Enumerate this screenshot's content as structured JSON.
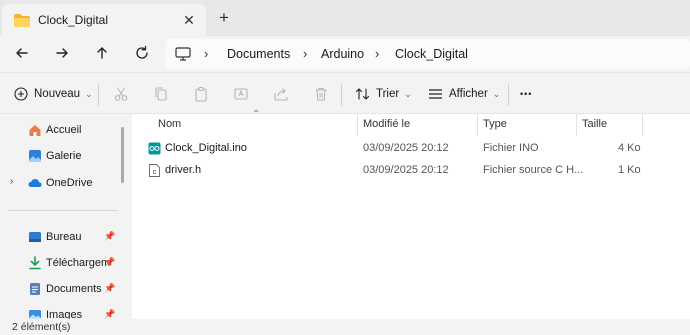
{
  "window": {
    "tab_title": "Clock_Digital",
    "close_symbol": "✕",
    "new_tab_symbol": "+"
  },
  "breadcrumb": [
    "Documents",
    "Arduino",
    "Clock_Digital"
  ],
  "breadcrumb_separator": "›",
  "commands": {
    "new_label": "Nouveau",
    "sort_label": "Trier",
    "view_label": "Afficher",
    "more_label": "•••"
  },
  "sidebar": {
    "items": [
      {
        "label": "Accueil",
        "icon": "home-icon"
      },
      {
        "label": "Galerie",
        "icon": "gallery-icon"
      },
      {
        "label": "OneDrive",
        "icon": "cloud-icon"
      },
      {
        "label": "Bureau",
        "icon": "desktop-icon"
      },
      {
        "label": "Téléchargem",
        "icon": "download-icon"
      },
      {
        "label": "Documents",
        "icon": "documents-icon"
      },
      {
        "label": "Images",
        "icon": "images-icon"
      }
    ],
    "expand_symbol": "›",
    "pin_symbol": "📌"
  },
  "columns": {
    "name": "Nom",
    "modified": "Modifié le",
    "type": "Type",
    "size": "Taille"
  },
  "sort_caret": "⌃",
  "files": [
    {
      "name": "Clock_Digital.ino",
      "modified": "03/09/2025 20:12",
      "type": "Fichier INO",
      "size": "4 Ko",
      "icon": "arduino-file-icon"
    },
    {
      "name": "driver.h",
      "modified": "03/09/2025 20:12",
      "type": "Fichier source C H...",
      "size": "1 Ko",
      "icon": "c-header-file-icon"
    }
  ],
  "status": {
    "count": "2 élément(s)"
  },
  "colors": {
    "accent": "#0067c0",
    "folder": "#f4c542",
    "arduino": "#00979c"
  }
}
